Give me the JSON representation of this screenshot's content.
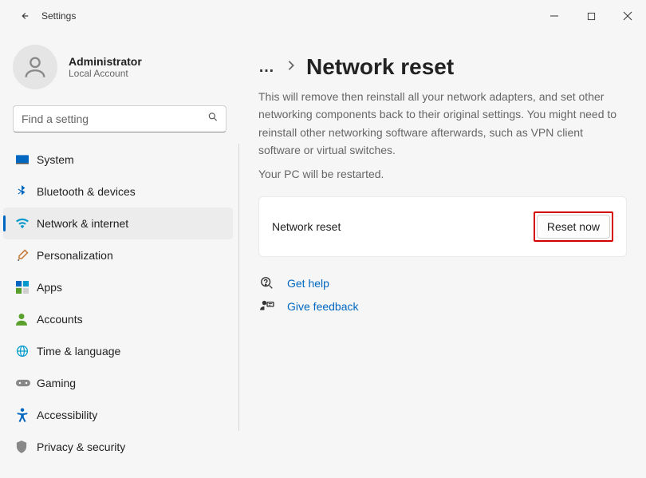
{
  "app": {
    "title": "Settings"
  },
  "user": {
    "name": "Administrator",
    "subtitle": "Local Account"
  },
  "search": {
    "placeholder": "Find a setting"
  },
  "nav": {
    "system": "System",
    "bluetooth": "Bluetooth & devices",
    "network": "Network & internet",
    "personalization": "Personalization",
    "apps": "Apps",
    "accounts": "Accounts",
    "time": "Time & language",
    "gaming": "Gaming",
    "accessibility": "Accessibility",
    "privacy": "Privacy & security"
  },
  "page": {
    "title": "Network reset",
    "description": "This will remove then reinstall all your network adapters, and set other networking components back to their original settings. You might need to reinstall other networking software afterwards, such as VPN client software or virtual switches.",
    "restart_note": "Your PC will be restarted.",
    "card_label": "Network reset",
    "reset_button": "Reset now"
  },
  "links": {
    "help": "Get help",
    "feedback": "Give feedback"
  }
}
